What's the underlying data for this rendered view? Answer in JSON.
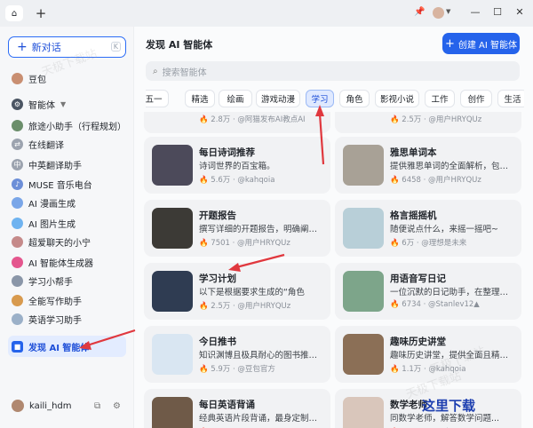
{
  "tabs": {
    "home_icon": "home-icon",
    "add_label": "+"
  },
  "sidebar": {
    "new_chat": "新对话",
    "new_chat_kbd": "K",
    "items": [
      {
        "label": "豆包",
        "color": "#c98f72",
        "glyph": ""
      },
      {
        "label": "智能体",
        "color": "#4b5563",
        "glyph": "⚙"
      },
      {
        "label": "旅途小助手（行程规划）",
        "color": "#6b8e6b",
        "glyph": ""
      },
      {
        "label": "在线翻译",
        "color": "#9ca3af",
        "glyph": "⇄"
      },
      {
        "label": "中英翻译助手",
        "color": "#9ca3af",
        "glyph": "中"
      },
      {
        "label": "MUSE 音乐电台",
        "color": "#6d8fd8",
        "glyph": "♪"
      },
      {
        "label": "AI 漫画生成",
        "color": "#7aa6e8",
        "glyph": ""
      },
      {
        "label": "AI 图片生成",
        "color": "#6fb3f0",
        "glyph": ""
      },
      {
        "label": "超爱聊天的小宁",
        "color": "#c58a8a",
        "glyph": ""
      },
      {
        "label": "AI 智能体生成器",
        "color": "#e4568e",
        "glyph": ""
      },
      {
        "label": "学习小帮手",
        "color": "#8a96a8",
        "glyph": ""
      },
      {
        "label": "全能写作助手",
        "color": "#d89a4e",
        "glyph": ""
      },
      {
        "label": "英语学习助手",
        "color": "#9bb0c8",
        "glyph": ""
      }
    ],
    "discover": "发现 AI 智能体",
    "user": "kaili_hdm"
  },
  "main": {
    "title": "发现 AI 智能体",
    "create_label": "创建 AI 智能体",
    "search_placeholder": "搜索智能体",
    "categories": [
      "五一",
      "精选",
      "绘画",
      "游戏动漫",
      "学习",
      "角色",
      "影视小说",
      "工作",
      "创作",
      "生活"
    ],
    "active_category": "学习",
    "partial_row": [
      {
        "meta": "🔥 2.8万 · @阿猫发布AI教点AI"
      },
      {
        "meta": "🔥 2.5万 · @用户HRYQUz"
      }
    ],
    "cards": [
      {
        "name": "每日诗词推荐",
        "desc": "诗词世界的百宝箱。",
        "meta": "🔥 5.6万 · @kahqoia",
        "thumb": "#4c4a5a"
      },
      {
        "name": "雅思单词本",
        "desc": "提供雅思单词的全面解析，包括...",
        "meta": "🔥 6458 · @用户HRYQUz",
        "thumb": "#a8a196"
      },
      {
        "name": "开题报告",
        "desc": "撰写详细的开题报告，明确阐述...",
        "meta": "🔥 7501 · @用户HRYQUz",
        "thumb": "#3c3a36"
      },
      {
        "name": "格言摇摇机",
        "desc": "随便说点什么，来摇一摇吧~",
        "meta": "🔥 6万 · @理想是未来",
        "thumb": "#b8cfd8"
      },
      {
        "name": "学习计划",
        "desc": "以下是根据要求生成的“角色",
        "meta": "🔥 2.5万 · @用户HRYQUz",
        "thumb": "#2f3c52"
      },
      {
        "name": "用语音写日记",
        "desc": "一位沉默的日记助手，在整理记...",
        "meta": "🔥 6734 · @Stanlev12▲",
        "thumb": "#7da58a"
      },
      {
        "name": "今日推书",
        "desc": "知识渊博且极具耐心的图书推荐...",
        "meta": "🔥 5.9万 · @豆包官方",
        "thumb": "#d9e6f2"
      },
      {
        "name": "趣味历史讲堂",
        "desc": "趣味历史讲堂，提供全面且精准...",
        "meta": "🔥 1.1万 · @kahqoia",
        "thumb": "#8b6f56"
      },
      {
        "name": "每日英语背诵",
        "desc": "经典英语片段背诵，最身定制，...",
        "meta": "🔥 1.3万 · @Stanlev12▲",
        "thumb": "#6f5a48"
      },
      {
        "name": "数学老师",
        "desc": "同数学老师，解答数学问题...",
        "meta": "🔥 2.9万 · @用户HRYQUz",
        "thumb": "#d9c6bb"
      }
    ]
  },
  "watermarks": [
    "天极下载站",
    "天极下载站",
    "天极下载站"
  ],
  "brand_watermark": "这里下载"
}
